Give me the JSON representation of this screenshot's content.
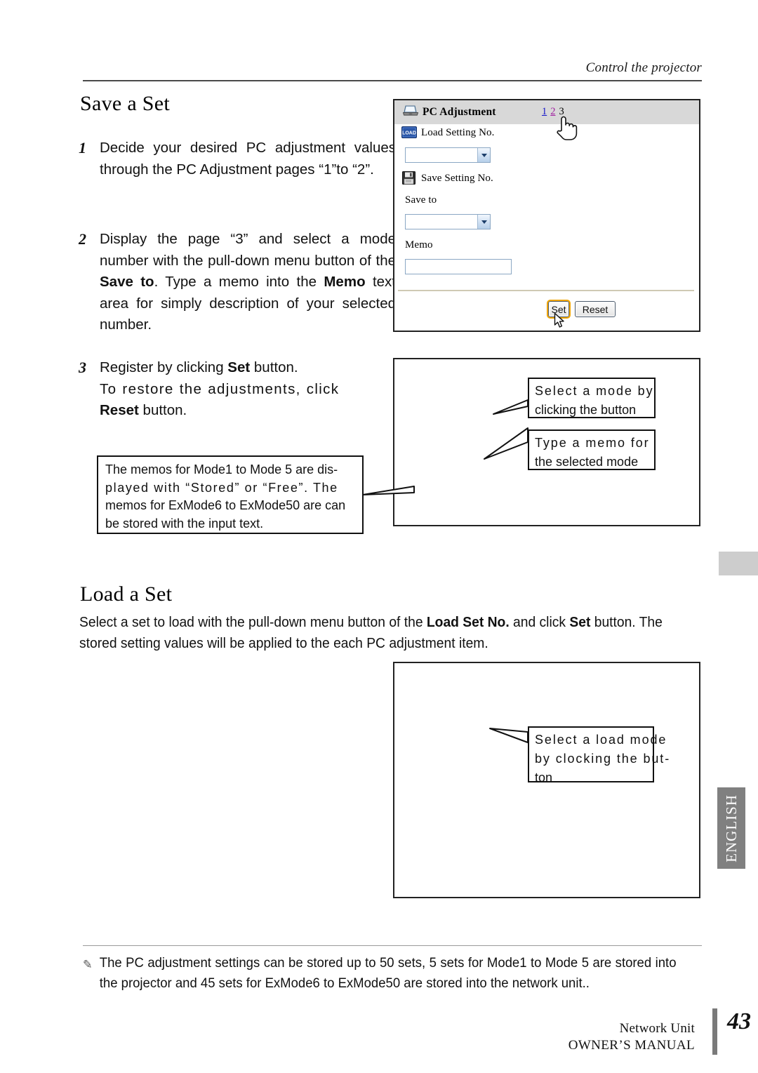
{
  "page": {
    "running_head": "Control the projector",
    "number": "43"
  },
  "sections": {
    "save": {
      "title": "Save a Set",
      "steps": [
        {
          "num": "1",
          "text_parts": [
            {
              "t": "Decide your desired PC adjustment values through the PC Adjustment pages “1”to “2”.",
              "bold": false
            }
          ]
        },
        {
          "num": "2",
          "lead": "Display the page “3” and select a mode number with the pull-down menu button of the ",
          "bold1": "Save to",
          "mid": ". Type a memo into the ",
          "bold2": "Memo",
          "tail": " text area for simply description of your selected number."
        },
        {
          "num": "3",
          "lead": "Register by clicking ",
          "bold1": "Set",
          "tail": " button.",
          "sub_line1": "To restore the adjustments, click",
          "sub_bold": "Reset",
          "sub_tail": " button."
        }
      ]
    },
    "load": {
      "title": "Load a Set",
      "para_lead": "Select a set to load with the pull-down menu  button of the ",
      "para_bold1": "Load Set No.",
      "para_mid": " and click ",
      "para_bold2": "Set",
      "para_tail": " button. The stored setting values will be applied to the each PC adjustment item."
    }
  },
  "browser": {
    "title": "PC Adjustment",
    "title_icon": "laptop-icon",
    "page_links": [
      {
        "label": "1",
        "state": "link"
      },
      {
        "label": "2",
        "state": "visited"
      },
      {
        "label": "3",
        "state": "current"
      }
    ],
    "load_setting_label": "Load Setting No.",
    "load_icon": "load-icon",
    "load_icon_text": "LOAD",
    "save_setting_label": "Save Setting No.",
    "save_icon": "floppy-disk-icon",
    "save_to_label": "Save to",
    "memo_label": "Memo",
    "memo_value": "",
    "load_select_value": "",
    "save_select_value": "",
    "buttons": {
      "set": "Set",
      "reset": "Reset"
    },
    "focus_color": "#f0a500",
    "link_color": "#1414c8",
    "visited_color": "#a020a0",
    "titlebar_color": "#d8d8d8"
  },
  "callouts": {
    "select_mode": {
      "line1": "Select a mode by",
      "line2": "clicking the button"
    },
    "type_memo": {
      "line1": "Type a memo for",
      "line2": "the selected mode"
    },
    "select_load_mode": {
      "line1": "Select a load mode",
      "line2": "by clocking the but-",
      "line3": "ton"
    },
    "memos_note": {
      "line1": "The memos for Mode1 to Mode 5 are dis-",
      "line2": "played with “Stored” or “Free”. The",
      "line3": "memos for ExMode6 to ExMode50 are can",
      "line4": "be stored with the input text."
    }
  },
  "footnote": {
    "marker": "✎",
    "text": "The PC adjustment settings can be stored up to 50 sets, 5 sets for Mode1 to Mode 5 are stored into the projector and 45 sets for ExMode6 to ExMode50 are stored into the network unit.."
  },
  "footer": {
    "line1": "Network Unit",
    "line2": "OWNER’S MANUAL",
    "tab_label": "ENGLISH",
    "tab_color": "#808080"
  }
}
